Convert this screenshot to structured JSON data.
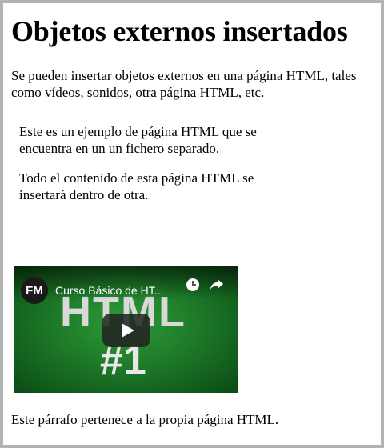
{
  "page": {
    "title": "Objetos externos insertados",
    "intro": "Se pueden insertar objetos externos en una página HTML, tales como vídeos, sonidos, otra página HTML, etc.",
    "footer": "Este párrafo pertenece a la propia página HTML."
  },
  "embedded_page": {
    "paragraphs": [
      "Este es un ejemplo de página HTML que se encuentra en un un fichero separado.",
      "Todo el contenido de esta página HTML se insertará dentro de otra."
    ]
  },
  "video": {
    "channel_badge": "FM",
    "title": "Curso Básico de HT...",
    "thumbnail_line1": "HTML",
    "thumbnail_line2": "#1",
    "icons": [
      "watch-later-icon",
      "share-icon",
      "play-icon"
    ],
    "colors": {
      "background": "#1d7a28",
      "play_button": "#212121"
    }
  }
}
